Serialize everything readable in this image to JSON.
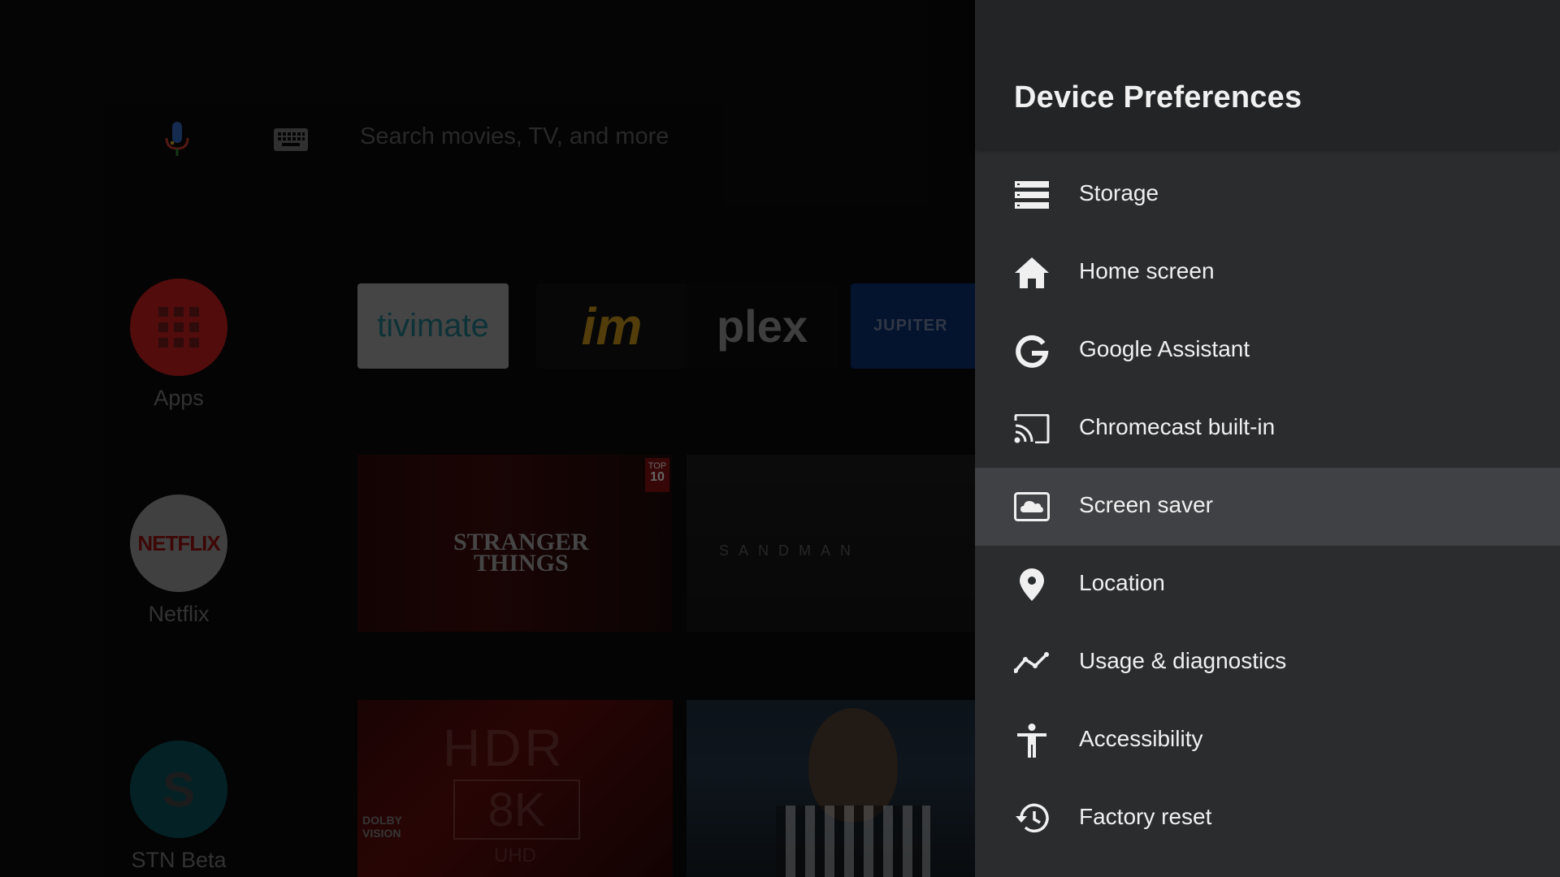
{
  "home": {
    "search_placeholder": "Search movies, TV, and more",
    "side_apps": [
      {
        "label": "Apps",
        "icon": "apps-grid-icon",
        "color": "#c62828"
      },
      {
        "label": "Netflix",
        "icon": "netflix-logo",
        "logo_text": "NETFLIX",
        "color": "#e8e8e8"
      },
      {
        "label": "STN Beta",
        "icon": "stn-logo",
        "logo_text": "S",
        "color": "#0f7a8a"
      }
    ],
    "app_tiles": [
      {
        "name": "tivimate",
        "text": "tivimate"
      },
      {
        "name": "im",
        "text": "im"
      },
      {
        "name": "plex",
        "text": "plex"
      },
      {
        "name": "jupiter",
        "text": "JUPITER"
      }
    ],
    "cards": {
      "stranger_things": {
        "title_line1": "STRANGER",
        "title_line2": "THINGS",
        "badge_line1": "TOP",
        "badge_line2": "10"
      },
      "sandman": {
        "title": "SANDMAN"
      },
      "hdr": {
        "big": "HDR",
        "res": "8K",
        "brand_line1": "DOLBY",
        "brand_line2": "VISION",
        "uhd": "UHD"
      }
    }
  },
  "panel": {
    "title": "Device Preferences",
    "items": [
      {
        "label": "Storage",
        "icon": "storage-icon"
      },
      {
        "label": "Home screen",
        "icon": "home-icon"
      },
      {
        "label": "Google Assistant",
        "icon": "google-g-icon"
      },
      {
        "label": "Chromecast built-in",
        "icon": "cast-icon"
      },
      {
        "label": "Screen saver",
        "icon": "screensaver-icon",
        "focused": true
      },
      {
        "label": "Location",
        "icon": "location-pin-icon"
      },
      {
        "label": "Usage & diagnostics",
        "icon": "usage-graph-icon"
      },
      {
        "label": "Accessibility",
        "icon": "accessibility-icon"
      },
      {
        "label": "Factory reset",
        "icon": "restore-history-icon"
      }
    ]
  },
  "colors": {
    "panel_bg": "#2b2c2e",
    "panel_header_bg": "#232425",
    "focused_item_bg": "#404144",
    "text": "#f0f0f0"
  }
}
